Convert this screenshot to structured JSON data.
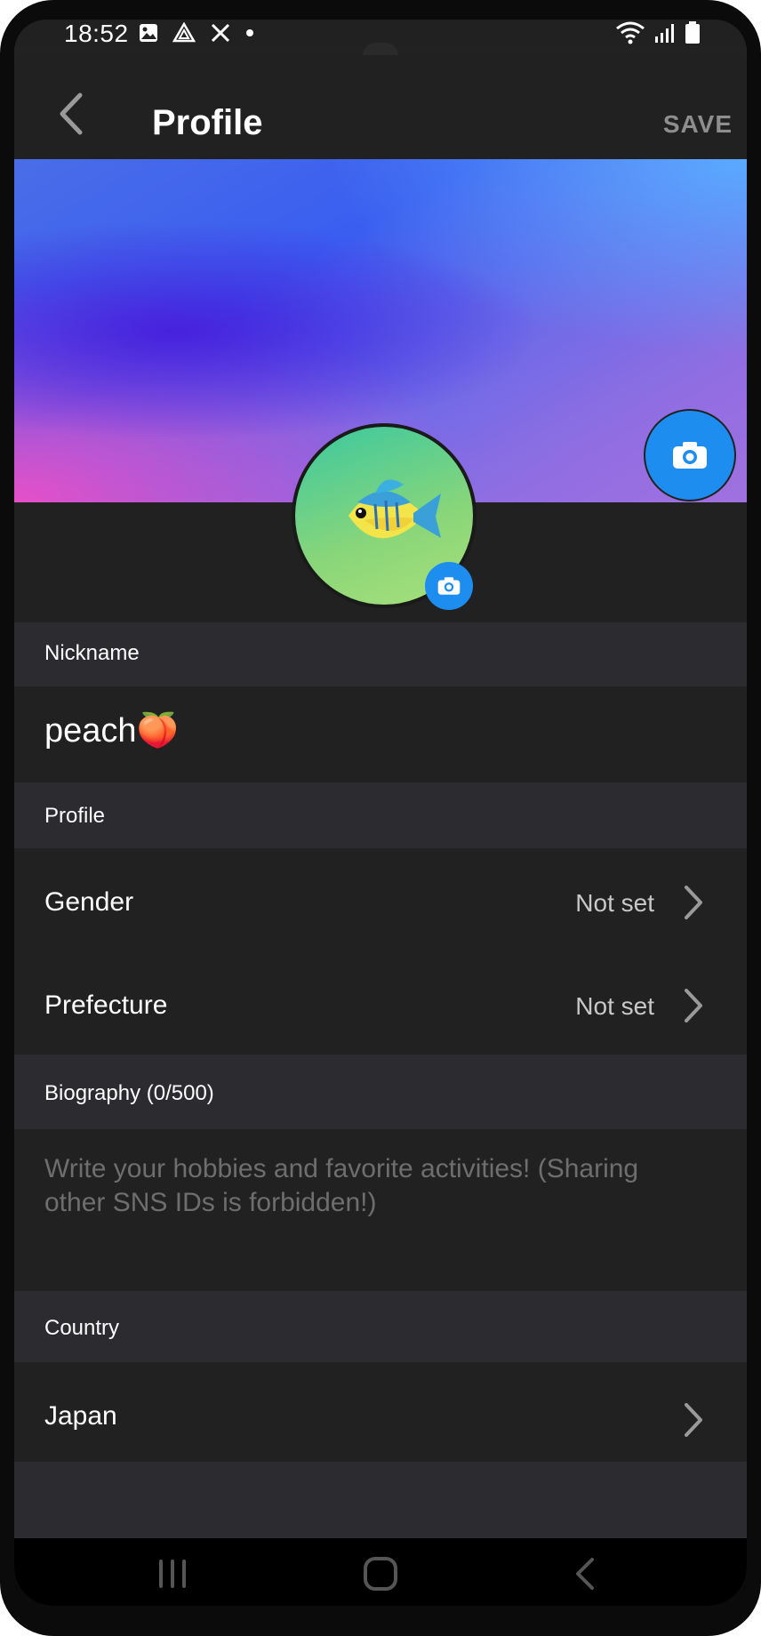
{
  "status_bar": {
    "time": "18:52",
    "left_icons": [
      "image-icon",
      "drive-icon",
      "x-icon",
      "dot-icon"
    ],
    "right_icons": [
      "wifi-icon",
      "signal-icon",
      "battery-icon"
    ]
  },
  "app_bar": {
    "title": "Profile",
    "save_label": "SAVE"
  },
  "header": {
    "cover_camera_icon": "camera-icon",
    "avatar_icon": "tropical-fish-emoji",
    "avatar_camera_icon": "camera-icon"
  },
  "nickname_section": {
    "header": "Nickname",
    "value": "peach🍑"
  },
  "profile_section": {
    "header": "Profile",
    "items": [
      {
        "label": "Gender",
        "value": "Not set"
      },
      {
        "label": "Prefecture",
        "value": "Not set"
      }
    ]
  },
  "biography_section": {
    "header": "Biography (0/500)",
    "placeholder": "Write your hobbies and favorite activities! (Sharing other SNS IDs is forbidden!)"
  },
  "country_section": {
    "header": "Country",
    "value": "Japan"
  },
  "nav_bar": {
    "items": [
      "recents-icon",
      "home-icon",
      "back-icon"
    ]
  },
  "colors": {
    "background": "#212121",
    "section_header": "#2b2b30",
    "accent_blue": "#1e8df0",
    "muted_text": "#8e8e8e",
    "placeholder_text": "#6e6e6e"
  }
}
